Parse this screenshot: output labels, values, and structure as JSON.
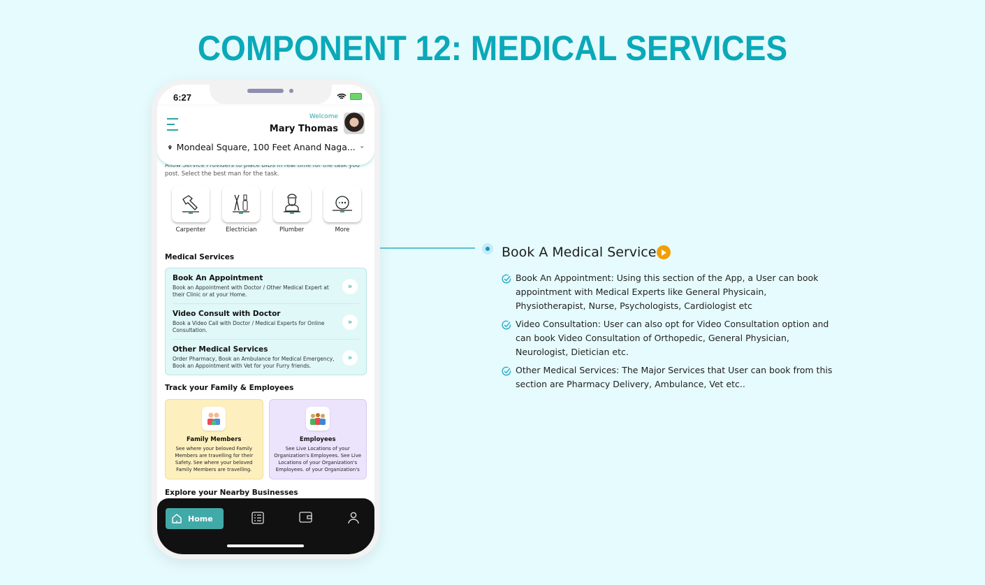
{
  "page": {
    "title": "COMPONENT 12: MEDICAL SERVICES"
  },
  "status_bar": {
    "time": "6:27"
  },
  "header": {
    "welcome": "Welcome",
    "user_name": "Mary Thomas",
    "location": "Mondeal Square, 100 Feet Anand Naga..."
  },
  "intro": "Allow Service Providers to place BIDs in real time for the task you post. Select the best man for the task.",
  "categories": [
    {
      "label": "Carpenter",
      "icon": "hammer-icon"
    },
    {
      "label": "Electrician",
      "icon": "pliers-screwdriver-icon"
    },
    {
      "label": "Plumber",
      "icon": "plumber-icon"
    },
    {
      "label": "More",
      "icon": "more-icon"
    }
  ],
  "medical": {
    "title": "Medical Services",
    "items": [
      {
        "title": "Book An Appointment",
        "desc": "Book an Appointment with Doctor / Other Medical Expert at their Clinic or at your Home."
      },
      {
        "title": "Video Consult with Doctor",
        "desc": "Book a Video Call with Doctor / Medical Experts for Online Consultation."
      },
      {
        "title": "Other Medical Services",
        "desc": "Order Pharmacy, Book an Ambulance for Medical Emergency, Book an Appointment with Vet for your Furry friends."
      }
    ]
  },
  "track": {
    "title": "Track your Family & Employees",
    "cards": [
      {
        "title": "Family Members",
        "desc": "See where your beloved Family Members are travelling for their Safety. See where your beloved Family Members are travelling."
      },
      {
        "title": "Employees",
        "desc": "See Live Locations of your Organization's Employees. See Live Locations of your Organization's Employees. of your Organization's"
      }
    ]
  },
  "explore": {
    "title": "Explore your Nearby Businesses"
  },
  "tabbar": {
    "home_label": "Home",
    "tabs": [
      "home-icon",
      "task-list-icon",
      "wallet-icon",
      "profile-icon"
    ]
  },
  "feature": {
    "title": "Book A Medical Service",
    "bullets": [
      "Book An Appointment: Using this section of the App, a User can book appointment with Medical Experts like General Physicain, Physiotherapist, Nurse, Psychologists, Cardiologist etc",
      "Video Consultation: User can also opt for Video Consultation option and can book Video Consultation of Orthopedic, General Physician, Neurologist, Dietician etc.",
      "Other Medical Services: The Major Services that User can book from this section are Pharmacy Delivery, Ambulance, Vet etc.."
    ]
  },
  "colors": {
    "accent": "#0aa9b9",
    "teal": "#2aa6a6",
    "play": "#f29f05",
    "background": "#e6fbfd"
  }
}
